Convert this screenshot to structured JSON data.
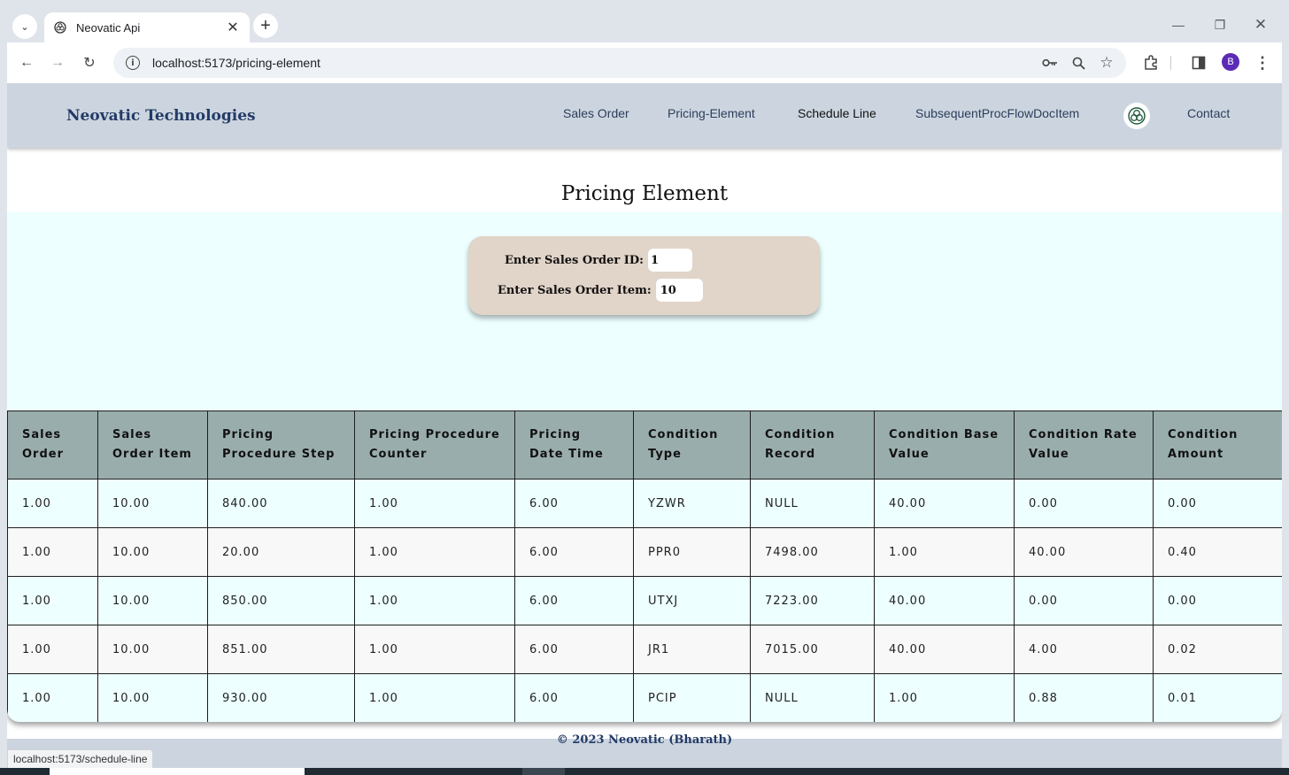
{
  "browser": {
    "tab_title": "Neovatic Api",
    "url": "localhost:5173/pricing-element",
    "profile_initial": "B",
    "status_url": "localhost:5173/schedule-line"
  },
  "navbar": {
    "brand": "Neovatic Technologies",
    "links": [
      "Sales Order",
      "Pricing-Element",
      "Schedule Line",
      "SubsequentProcFlowDocItem",
      "Contact"
    ]
  },
  "page": {
    "title": "Pricing Element",
    "form": {
      "sales_order_id_label": "Enter Sales Order ID:",
      "sales_order_id_value": "1",
      "sales_order_item_label": "Enter Sales Order Item:",
      "sales_order_item_value": "10"
    }
  },
  "table": {
    "headers": [
      "Sales Order",
      "Sales Order Item",
      "Pricing Procedure Step",
      "Pricing Procedure Counter",
      "Pricing Date Time",
      "Condition Type",
      "Condition Record",
      "Condition Base Value",
      "Condition Rate Value",
      "Condition Amount"
    ],
    "rows": [
      [
        "1.00",
        "10.00",
        "840.00",
        "1.00",
        "6.00",
        "YZWR",
        "NULL",
        "40.00",
        "0.00",
        "0.00"
      ],
      [
        "1.00",
        "10.00",
        "20.00",
        "1.00",
        "6.00",
        "PPR0",
        "7498.00",
        "1.00",
        "40.00",
        "0.40"
      ],
      [
        "1.00",
        "10.00",
        "850.00",
        "1.00",
        "6.00",
        "UTXJ",
        "7223.00",
        "40.00",
        "0.00",
        "0.00"
      ],
      [
        "1.00",
        "10.00",
        "851.00",
        "1.00",
        "6.00",
        "JR1",
        "7015.00",
        "40.00",
        "4.00",
        "0.02"
      ],
      [
        "1.00",
        "10.00",
        "930.00",
        "1.00",
        "6.00",
        "PCIP",
        "NULL",
        "1.00",
        "0.88",
        "0.01"
      ]
    ]
  },
  "footer": {
    "text": "© 2023 Neovatic (Bharath)"
  }
}
